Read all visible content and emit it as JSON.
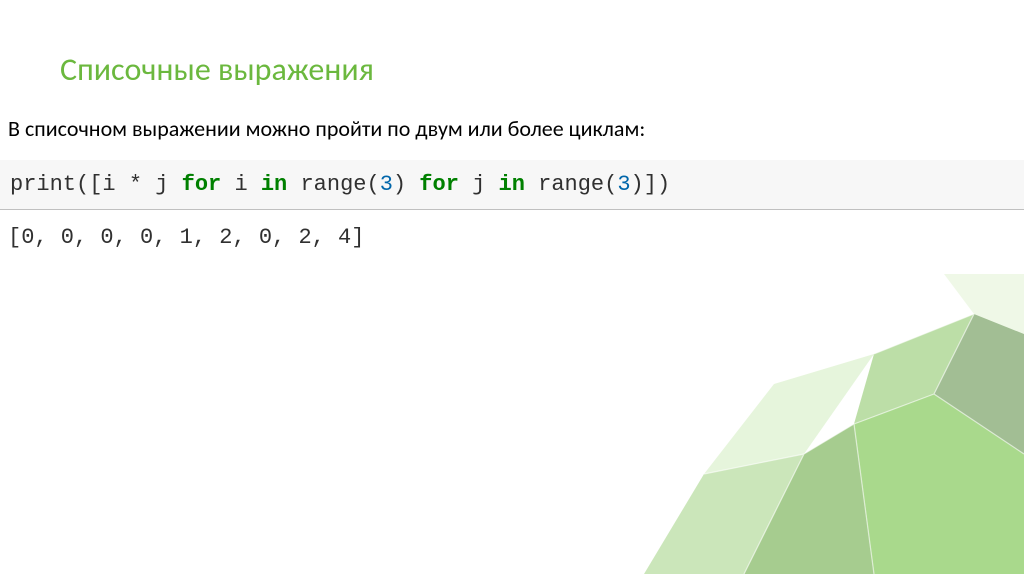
{
  "slide": {
    "title": "Списочные выражения",
    "description": "В списочном выражении можно пройти по двум или более циклам:",
    "code": {
      "t1": "print([i * j ",
      "kw1": "for",
      "t2": " i ",
      "kw2": "in",
      "t3": " range(",
      "n1": "3",
      "t4": ") ",
      "kw3": "for",
      "t5": " j ",
      "kw4": "in",
      "t6": " range(",
      "n2": "3",
      "t7": ")])"
    },
    "output": "[0, 0, 0, 0, 1, 2, 0, 2, 4]"
  }
}
